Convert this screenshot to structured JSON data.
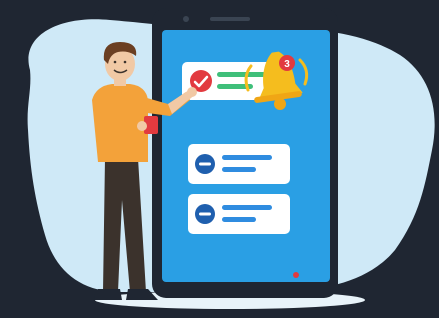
{
  "notification": {
    "badge_count": "3",
    "items": [
      {
        "status": "checked"
      },
      {
        "status": "pending"
      },
      {
        "status": "pending"
      }
    ]
  },
  "colors": {
    "background": "#1f2632",
    "blob": "#cfe9f7",
    "screen": "#2a9fe4",
    "phone": "#1f2632",
    "card": "#ffffff",
    "accent_red": "#e23a3f",
    "bell": "#f5bd1e",
    "line_green": "#3fbf7a",
    "line_blue": "#2f8ce0",
    "shirt": "#f3a23a",
    "pants": "#3b322c"
  },
  "icons": [
    "bell-icon",
    "check-icon",
    "minus-icon",
    "minus-icon"
  ]
}
